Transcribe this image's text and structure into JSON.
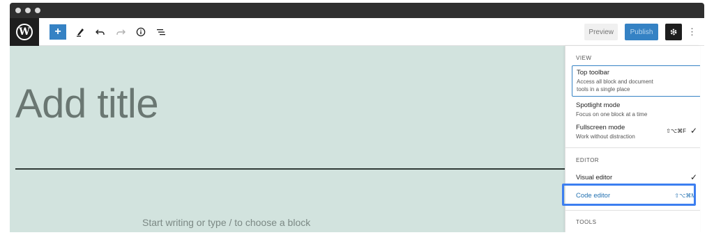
{
  "window": {
    "title": ""
  },
  "toolbar": {
    "logo_letter": "W",
    "add_label": "+",
    "preview_label": "Preview",
    "publish_label": "Publish"
  },
  "editor": {
    "title_placeholder": "Add title",
    "block_hint": "Start writing or type / to choose a block"
  },
  "menu": {
    "view_heading": "VIEW",
    "editor_heading": "EDITOR",
    "tools_heading": "TOOLS",
    "top_toolbar": {
      "label": "Top toolbar",
      "desc1": "Access all block and document",
      "desc2": "tools in a single place"
    },
    "spotlight": {
      "label": "Spotlight mode",
      "desc": "Focus on one block at a time"
    },
    "fullscreen": {
      "label": "Fullscreen mode",
      "desc": "Work without distraction",
      "shortcut": "⇧⌥⌘F",
      "checked": true
    },
    "visual_editor": {
      "label": "Visual editor",
      "checked": true
    },
    "code_editor": {
      "label": "Code editor",
      "shortcut": "⇧⌥⌘M"
    }
  },
  "icons": {
    "wordpress": "wordpress-logo-icon",
    "pencil": "pencil-icon",
    "undo": "undo-icon",
    "redo": "redo-icon",
    "info": "info-icon",
    "list": "list-view-icon",
    "gear": "gear-icon",
    "kebab": "more-options-icon"
  },
  "colors": {
    "accent": "#3582c4",
    "canvas": "#d2e3de",
    "highlight": "#3c7ef0",
    "dark": "#1e1e1e"
  }
}
